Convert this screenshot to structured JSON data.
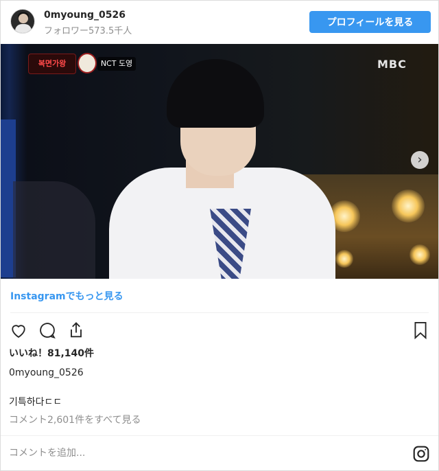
{
  "header": {
    "username": "0myoung_0526",
    "followers": "フォロワー573.5千人",
    "profile_button": "プロフィールを見る"
  },
  "media": {
    "show_badge": "복면가왕",
    "name_tag": "NCT 도영",
    "channel_logo": "MBC",
    "next_icon": "chevron-right-icon"
  },
  "more_link": "Instagramでもっと見る",
  "actions": {
    "icons": [
      "heart-icon",
      "comment-icon",
      "share-icon",
      "bookmark-icon"
    ]
  },
  "likes": "いいね！81,140件",
  "caption": {
    "username": "0myoung_0526",
    "text": "기특하다ㄷㄷ"
  },
  "comments_link": "コメント2,601件をすべて見る",
  "comment_input": {
    "placeholder": "コメントを追加..."
  },
  "colors": {
    "accent": "#3897f0",
    "muted": "#8e8e8e",
    "text": "#262626"
  }
}
